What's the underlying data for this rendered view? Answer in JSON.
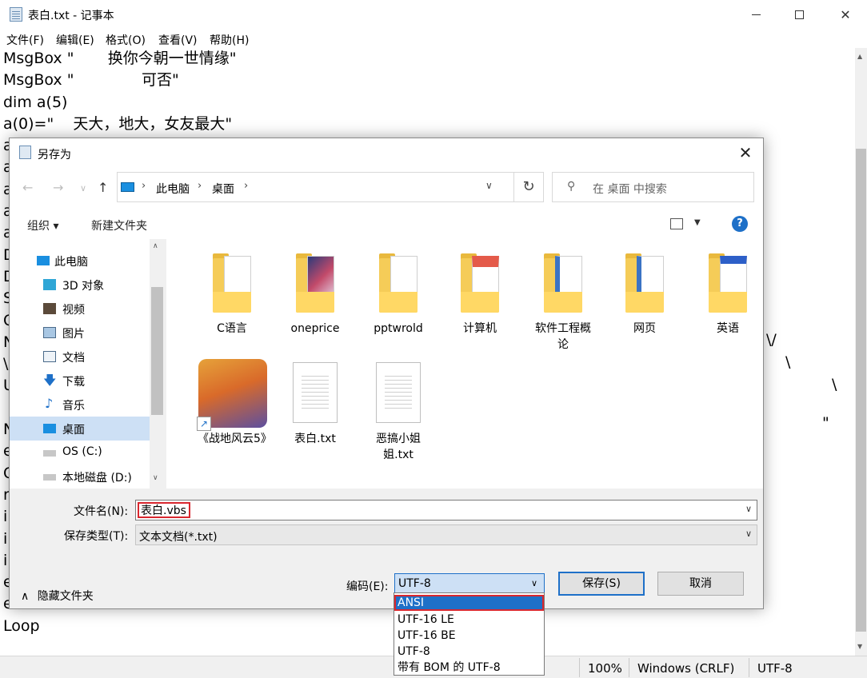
{
  "notepad": {
    "title": "表白.txt - 记事本",
    "menu": [
      "文件(F)",
      "编辑(E)",
      "格式(O)",
      "查看(V)",
      "帮助(H)"
    ],
    "lines_top": [
      "MsgBox \"       换你今朝一世情缘\"",
      "MsgBox \"              可否\"",
      "dim a(5)",
      "a(0)=\"    天大，地大，女友最大\""
    ],
    "left_fragments": [
      "a",
      "a",
      "a",
      "a",
      "a",
      "D",
      "D",
      "S",
      "C",
      "N",
      "\\",
      "U",
      "",
      "N",
      "e",
      "C",
      "r",
      "i",
      "i",
      "i",
      "e"
    ],
    "right_fragments": [
      "\\/",
      "\\",
      "\\",
      "\""
    ],
    "lines_bottom": [
      "end Select",
      "Loop"
    ],
    "status": {
      "zoom": "100%",
      "eol": "Windows (CRLF)",
      "encoding": "UTF-8"
    }
  },
  "dialog": {
    "title": "另存为",
    "path": [
      "此电脑",
      "桌面"
    ],
    "search_placeholder": "在 桌面 中搜索",
    "toolbar": {
      "organize": "组织 ▾",
      "new_folder": "新建文件夹"
    },
    "help": "?",
    "tree": [
      {
        "label": "此电脑",
        "icon": "computer-icon"
      },
      {
        "label": "3D 对象",
        "icon": "3d-objects-icon"
      },
      {
        "label": "视频",
        "icon": "video-icon"
      },
      {
        "label": "图片",
        "icon": "pictures-icon"
      },
      {
        "label": "文档",
        "icon": "documents-icon"
      },
      {
        "label": "下载",
        "icon": "download-icon"
      },
      {
        "label": "音乐",
        "icon": "music-icon"
      },
      {
        "label": "桌面",
        "icon": "desktop-icon",
        "selected": true
      },
      {
        "label": "OS (C:)",
        "icon": "drive-c-icon"
      },
      {
        "label": "本地磁盘 (D:)",
        "icon": "drive-d-icon"
      }
    ],
    "files": [
      {
        "name": "C语言",
        "kind": "folder"
      },
      {
        "name": "oneprice",
        "kind": "folder"
      },
      {
        "name": "pptwrold",
        "kind": "folder"
      },
      {
        "name": "计算机",
        "kind": "folder"
      },
      {
        "name": "软件工程概论",
        "kind": "folder"
      },
      {
        "name": "网页",
        "kind": "folder"
      },
      {
        "name": "英语",
        "kind": "folder"
      },
      {
        "name": "《战地风云5》",
        "kind": "shortcut"
      },
      {
        "name": "表白.txt",
        "kind": "text"
      },
      {
        "name": "恶搞小姐姐.txt",
        "kind": "text"
      }
    ],
    "filename_label": "文件名(N):",
    "filename_value": "表白.vbs",
    "filetype_label": "保存类型(T):",
    "filetype_value": "文本文档(*.txt)",
    "hide_folders": "隐藏文件夹",
    "encoding_label": "编码(E):",
    "encoding_value": "UTF-8",
    "encoding_options": [
      "ANSI",
      "UTF-16 LE",
      "UTF-16 BE",
      "UTF-8",
      "带有 BOM 的 UTF-8"
    ],
    "save": "保存(S)",
    "cancel": "取消"
  },
  "colors": {
    "highlight": "#d9272e",
    "selection": "#1e70c8",
    "folder": "#f5cc58"
  }
}
